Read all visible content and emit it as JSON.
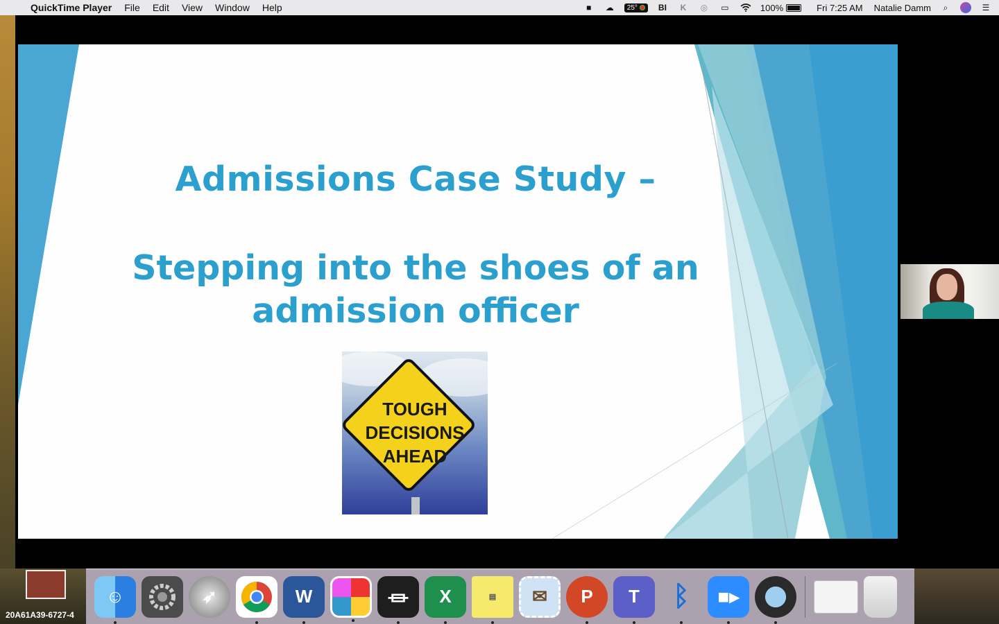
{
  "menubar": {
    "app_name": "QuickTime Player",
    "menus": [
      "File",
      "Edit",
      "View",
      "Window",
      "Help"
    ],
    "weather": "25°",
    "battery": "100%",
    "battery_level": 1.0,
    "clock": "Fri 7:25 AM",
    "user": "Natalie Damm"
  },
  "slide": {
    "title": "Admissions Case Study –",
    "subtitle_line1": "Stepping into the shoes of an",
    "subtitle_line2": "admission officer",
    "sign_lines": [
      "TOUGH",
      "DECISIONS",
      "AHEAD"
    ],
    "title_color": "#2b9fcd"
  },
  "desktop": {
    "item_label": "20A61A39-6727-4"
  },
  "dock": {
    "apps": [
      {
        "name": "Finder",
        "icon": "finder-icon"
      },
      {
        "name": "System Preferences",
        "icon": "gear-icon"
      },
      {
        "name": "Launchpad",
        "icon": "rocket-icon"
      },
      {
        "name": "Google Chrome",
        "icon": "chrome-icon"
      },
      {
        "name": "Microsoft Word",
        "icon": "word-icon",
        "glyph": "W"
      },
      {
        "name": "Keynote-like",
        "icon": "shapes-app-icon"
      },
      {
        "name": "Adobe Acrobat",
        "icon": "acrobat-icon"
      },
      {
        "name": "Microsoft Excel",
        "icon": "excel-icon",
        "glyph": "X"
      },
      {
        "name": "Stickies",
        "icon": "stickies-icon"
      },
      {
        "name": "Mail",
        "icon": "mail-stamp-icon"
      },
      {
        "name": "Microsoft PowerPoint",
        "icon": "powerpoint-icon",
        "glyph": "P"
      },
      {
        "name": "Microsoft Teams",
        "icon": "teams-icon",
        "glyph": "T"
      },
      {
        "name": "Bluetooth File Exchange",
        "icon": "bluetooth-icon"
      },
      {
        "name": "Zoom",
        "icon": "zoom-icon"
      },
      {
        "name": "QuickTime Player",
        "icon": "quicktime-icon"
      }
    ]
  }
}
